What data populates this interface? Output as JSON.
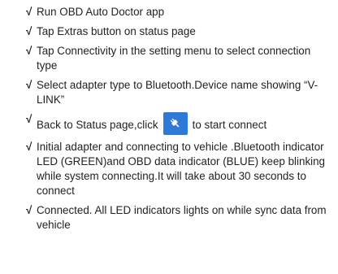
{
  "steps": [
    {
      "check": "√",
      "text": "Run OBD Auto Doctor app"
    },
    {
      "check": "√",
      "text": "Tap Extras button on status page"
    },
    {
      "check": "√",
      "text": "Tap Connectivity in the setting menu to select connection type"
    },
    {
      "check": "√",
      "text": "Select adapter type to Bluetooth.Device name showing “V-LINK”"
    },
    {
      "check": "√",
      "text_before": "Back to Status page,click",
      "text_after": "to start connect",
      "icon": "connect-plug-icon"
    },
    {
      "check": "√",
      "text": "Initial adapter and connecting to vehicle .Bluetooth indicator LED (GREEN)and OBD data indicator (BLUE) keep blinking while system connecting.It will take about 30 seconds to connect"
    },
    {
      "check": "√",
      "text": "Connected. All LED indicators lights on while sync data from vehicle"
    }
  ],
  "colors": {
    "button": "#2f7ad6",
    "text": "#222222"
  }
}
